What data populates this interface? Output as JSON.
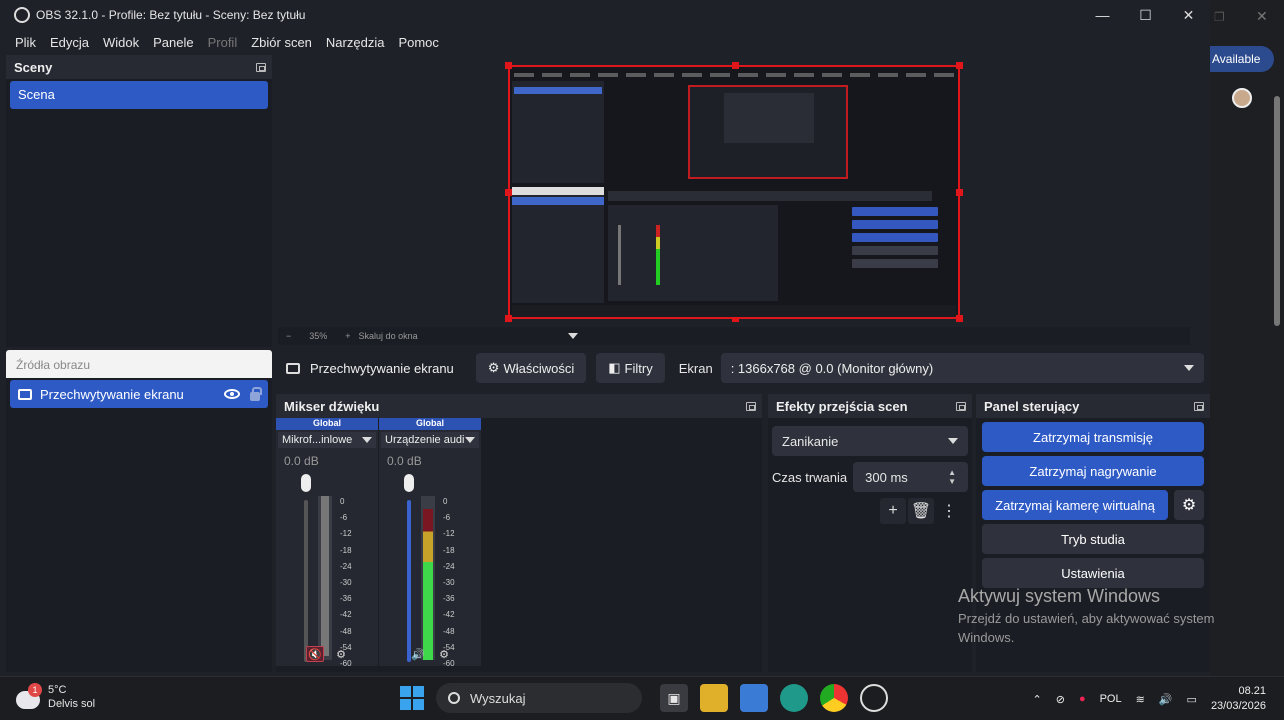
{
  "window": {
    "title": "OBS 32.1.0 - Profile: Bez tytułu - Sceny: Bez tytułu",
    "controls": [
      "—",
      "☐",
      "✕"
    ]
  },
  "menu": [
    "Plik",
    "Edycja",
    "Widok",
    "Panele",
    "Profil",
    "Zbiór scen",
    "Narzędzia",
    "Pomoc"
  ],
  "scenes": {
    "title": "Sceny",
    "items": [
      "Scena"
    ]
  },
  "sources": {
    "placeholder": "Źródła obrazu",
    "items": [
      {
        "label": "Przechwytywanie ekranu",
        "visible": true,
        "locked": false
      }
    ]
  },
  "preview": {
    "zoom": "35%",
    "minus": "−",
    "plus": "+",
    "scale_label": "Skaluj do okna"
  },
  "toolbar": {
    "source_name": "Przechwytywanie ekranu",
    "properties": "Właściwości",
    "filters": "Filtry",
    "screen_label": "Ekran",
    "screen_value": ": 1366x768 @ 0.0 (Monitor główny)"
  },
  "mixer": {
    "title": "Mikser dźwięku",
    "channels": [
      {
        "group": "Global",
        "name": "Mikrof...inlowe",
        "db": "0.0 dB",
        "muted": true,
        "level": 0
      },
      {
        "group": "Global",
        "name": "Urządzenie audio",
        "db": "0.0 dB",
        "muted": false,
        "level": 0.92
      }
    ],
    "scale": [
      "0",
      "-6",
      "-12",
      "-18",
      "-24",
      "-30",
      "-36",
      "-42",
      "-48",
      "-54",
      "-60"
    ]
  },
  "transitions": {
    "title": "Efekty przejścia scen",
    "selected": "Zanikanie",
    "duration_label": "Czas trwania",
    "duration_value": "300 ms"
  },
  "controls": {
    "title": "Panel sterujący",
    "stop_stream": "Zatrzymaj transmisję",
    "stop_record": "Zatrzymaj nagrywanie",
    "stop_virtualcam": "Zatrzymaj kamerę wirtualną",
    "studio_mode": "Tryb studia",
    "settings": "Ustawienia"
  },
  "watermark": {
    "title": "Aktywuj system Windows",
    "text": "Przejdź do ustawień, aby aktywować system Windows."
  },
  "background": {
    "available_label": "Available"
  },
  "taskbar": {
    "weather_temp": "5°C",
    "weather_desc": "Delvis sol",
    "weather_badge": "1",
    "search": "Wyszukaj",
    "lang": "POL",
    "time": "08.21",
    "date": "23/03/2026"
  },
  "colors": {
    "accent": "#2e5ac6",
    "selection_border": "#e0161b",
    "bg": "#1f2129"
  }
}
